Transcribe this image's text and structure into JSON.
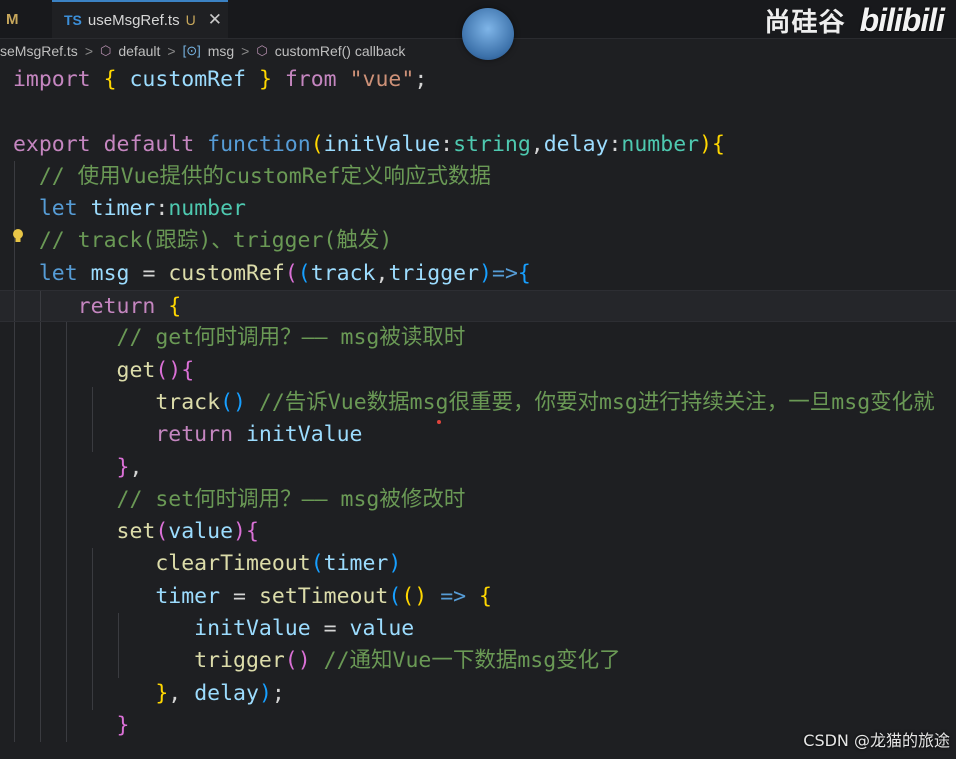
{
  "tabs": {
    "left_badge": "M",
    "active": {
      "lang_badge": "TS",
      "name": "useMsgRef.ts",
      "status": "U",
      "close": "✕"
    }
  },
  "watermark": {
    "brand_cn": "尚硅谷",
    "bilibili": "bilibili",
    "csdn": "CSDN @龙猫的旅途"
  },
  "breadcrumb": [
    "seMsgRef.ts",
    "default",
    "msg",
    "customRef() callback"
  ],
  "code": {
    "l1": [
      "import",
      "{",
      "customRef",
      "}",
      "from",
      "\"vue\"",
      ";"
    ],
    "l3": [
      "export",
      "default",
      "function",
      "(",
      "initValue",
      ":",
      "string",
      ",",
      "delay",
      ":",
      "number",
      ")",
      "{"
    ],
    "l4": "// 使用Vue提供的customRef定义响应式数据",
    "l5": [
      "let",
      "timer",
      ":",
      "number"
    ],
    "l6": "// track(跟踪)、trigger(触发)",
    "l7": [
      "let",
      "msg",
      "=",
      "customRef",
      "(",
      "(",
      "track",
      ",",
      "trigger",
      ")",
      "=>",
      "{"
    ],
    "l8": [
      "return",
      "{"
    ],
    "l9": "// get何时调用？—— msg被读取时",
    "l10": [
      "get",
      "()",
      "{"
    ],
    "l11": [
      "track",
      "()",
      "//告诉Vue数据msg很重要，你要对msg进行持续关注，一旦msg变化就"
    ],
    "l12": [
      "return",
      "initValue"
    ],
    "l13": [
      "}",
      ","
    ],
    "l14": "// set何时调用？—— msg被修改时",
    "l15": [
      "set",
      "(",
      "value",
      ")",
      "{"
    ],
    "l16": [
      "clearTimeout",
      "(",
      "timer",
      ")"
    ],
    "l17": [
      "timer",
      "=",
      "setTimeout",
      "(",
      "()",
      "=>",
      "{"
    ],
    "l18": [
      "initValue",
      "=",
      "value"
    ],
    "l19": [
      "trigger",
      "()",
      "//通知Vue一下数据msg变化了"
    ],
    "l20": [
      "}",
      ",",
      "delay",
      ")",
      ";"
    ],
    "l21": [
      "}"
    ]
  },
  "colors": {
    "keyword": "#c586c0",
    "keyword_blue": "#569cd6",
    "function": "#dcdcaa",
    "identifier": "#9cdcfe",
    "type": "#4ec9b0",
    "string": "#ce9178",
    "comment": "#6a9955"
  }
}
